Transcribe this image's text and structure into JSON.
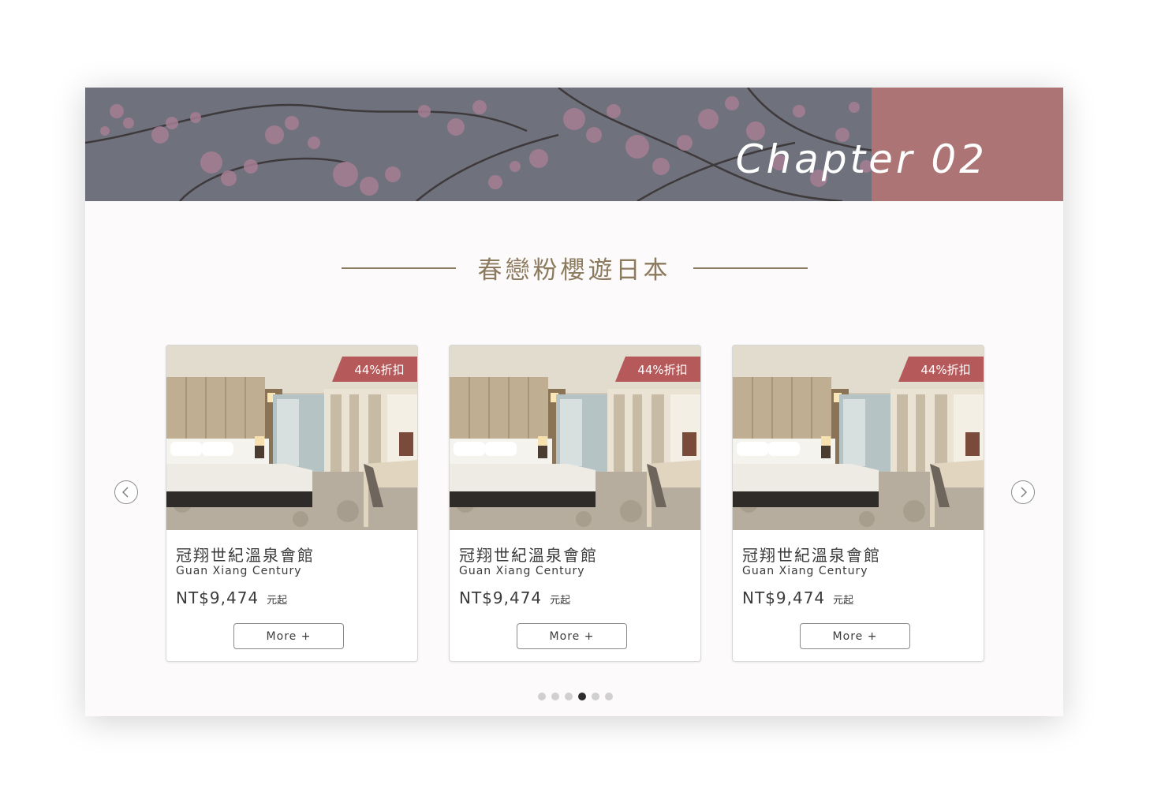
{
  "banner": {
    "chapter": "Chapter 02",
    "accent_color": "#ac7474"
  },
  "section": {
    "title": "春戀粉櫻遊日本"
  },
  "carousel": {
    "prev_icon": "chevron-left-icon",
    "next_icon": "chevron-right-icon",
    "cards": [
      {
        "badge": "44%折扣",
        "name_zh": "冠翔世紀溫泉會館",
        "name_en": "Guan Xiang Century",
        "price": "NT$9,474",
        "price_suffix": "元起",
        "button": "More +"
      },
      {
        "badge": "44%折扣",
        "name_zh": "冠翔世紀溫泉會館",
        "name_en": "Guan Xiang Century",
        "price": "NT$9,474",
        "price_suffix": "元起",
        "button": "More +"
      },
      {
        "badge": "44%折扣",
        "name_zh": "冠翔世紀溫泉會館",
        "name_en": "Guan Xiang Century",
        "price": "NT$9,474",
        "price_suffix": "元起",
        "button": "More +"
      }
    ],
    "pagination": {
      "total": 6,
      "active_index": 3
    }
  }
}
